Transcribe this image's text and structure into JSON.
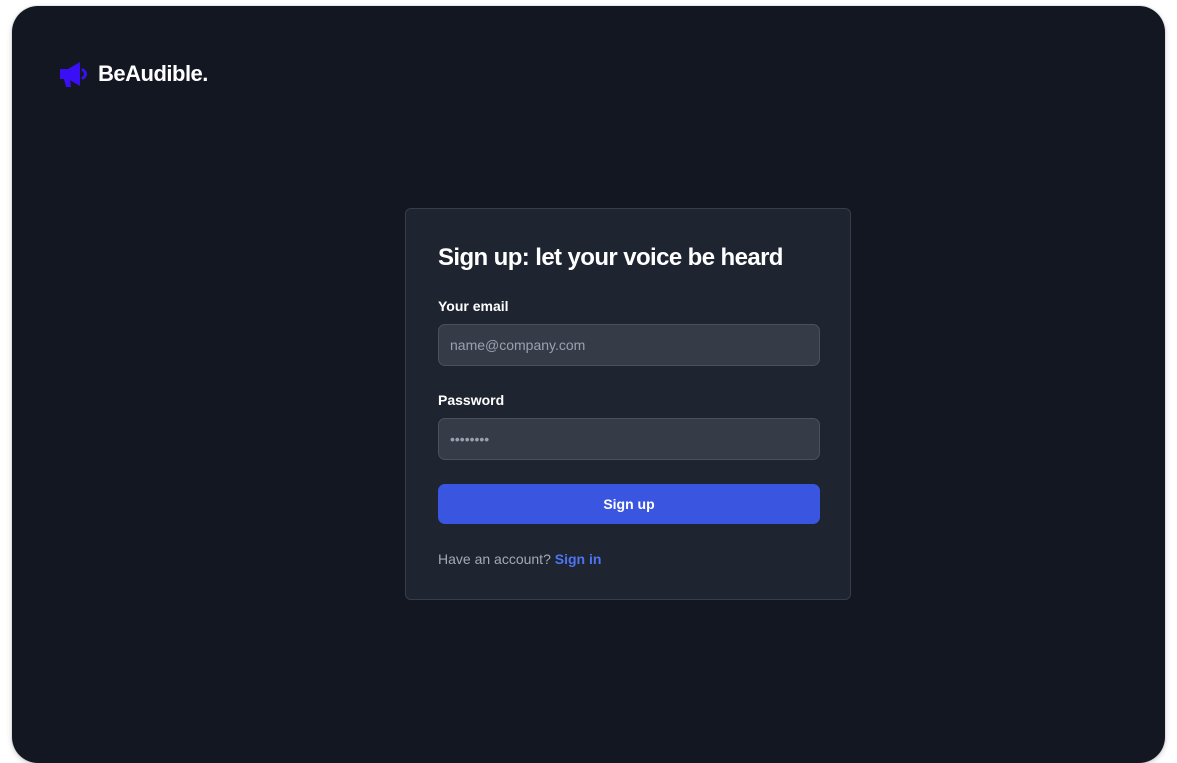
{
  "brand": {
    "name": "BeAudible.",
    "icon": "megaphone-icon",
    "accent_color": "#3a0ff5"
  },
  "signup": {
    "title": "Sign up: let your voice be heard",
    "email": {
      "label": "Your email",
      "placeholder": "name@company.com",
      "value": ""
    },
    "password": {
      "label": "Password",
      "placeholder": "••••••••",
      "value": ""
    },
    "submit_label": "Sign up",
    "footer": {
      "prompt": "Have an account?",
      "link_label": "Sign in"
    }
  },
  "colors": {
    "background": "#131722",
    "card": "#1f2431",
    "input": "#363b48",
    "primary_button": "#3a56e1",
    "link": "#4f74f0"
  }
}
